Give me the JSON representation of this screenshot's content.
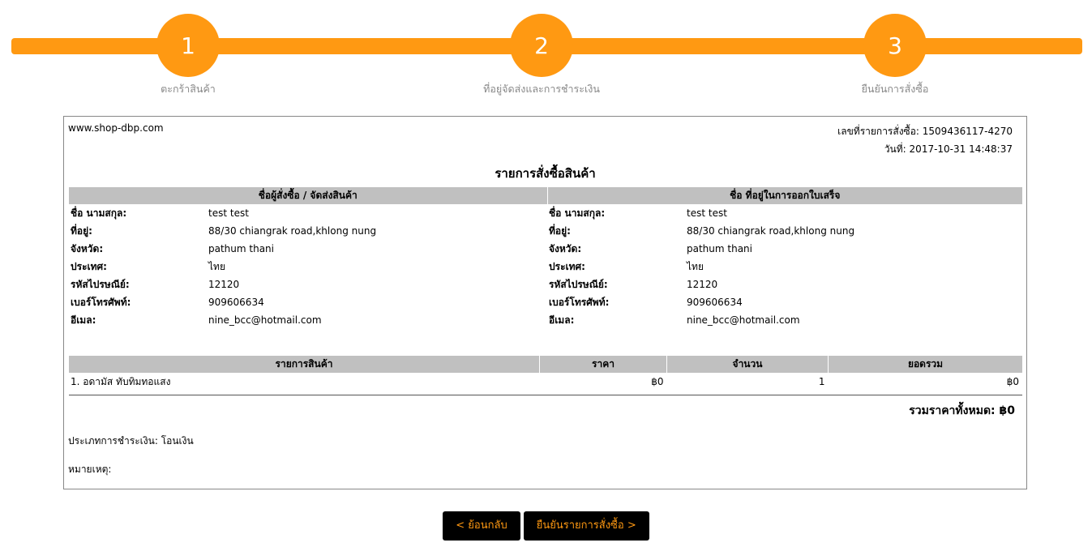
{
  "steps": [
    {
      "number": "1",
      "label": "ตะกร้าสินค้า"
    },
    {
      "number": "2",
      "label": "ที่อยู่จัดส่งและการชำระเงิน"
    },
    {
      "number": "3",
      "label": "ยืนยันการสั่งซื้อ"
    }
  ],
  "colors": {
    "accent": "#ff9912",
    "header_gray": "#c0c0c0",
    "button_bg": "#000000"
  },
  "receipt": {
    "site": "www.shop-dbp.com",
    "order_no_label": "เลขที่รายการสั่งซื้อ:",
    "order_no": "1509436117-4270",
    "date_label": "วันที่:",
    "date": "2017-10-31 14:48:37",
    "title": "รายการสั่งซื้อสินค้า",
    "shipping_header": "ชื่อผู้สั่งซื้อ / จัดส่งสินค้า",
    "billing_header": "ชื่อ ที่อยู่ในการออกใบเสร็จ",
    "shipping": [
      {
        "label": "ชื่อ นามสกุล:",
        "value": "test test"
      },
      {
        "label": "ที่อยู่:",
        "value": "88/30 chiangrak road,khlong nung"
      },
      {
        "label": "จังหวัด:",
        "value": "pathum thani"
      },
      {
        "label": "ประเทศ:",
        "value": "ไทย"
      },
      {
        "label": "รหัสไปรษณีย์:",
        "value": "12120"
      },
      {
        "label": "เบอร์โทรศัพท์:",
        "value": "909606634"
      },
      {
        "label": "อีเมล:",
        "value": "nine_bcc@hotmail.com"
      }
    ],
    "billing": [
      {
        "label": "ชื่อ นามสกุล:",
        "value": "test test"
      },
      {
        "label": "ที่อยู่:",
        "value": "88/30 chiangrak road,khlong nung"
      },
      {
        "label": "จังหวัด:",
        "value": "pathum thani"
      },
      {
        "label": "ประเทศ:",
        "value": "ไทย"
      },
      {
        "label": "รหัสไปรษณีย์:",
        "value": "12120"
      },
      {
        "label": "เบอร์โทรศัพท์:",
        "value": "909606634"
      },
      {
        "label": "อีเมล:",
        "value": "nine_bcc@hotmail.com"
      }
    ],
    "items_headers": {
      "product": "รายการสินค้า",
      "price": "ราคา",
      "qty": "จำนวน",
      "subtotal": "ยอดรวม"
    },
    "items": [
      {
        "name": "1. อดามัส ทับทิมทอแสง",
        "price": "฿0",
        "qty": "1",
        "subtotal": "฿0"
      }
    ],
    "total_label": "รวมราคาทั้งหมด:",
    "total_value": "฿0",
    "payment_label": "ประเภทการชำระเงิน:",
    "payment_value": "โอนเงิน",
    "note_label": "หมายเหตุ:"
  },
  "buttons": {
    "back": "< ย้อนกลับ",
    "confirm": "ยืนยันรายการสั่งซื้อ >"
  }
}
